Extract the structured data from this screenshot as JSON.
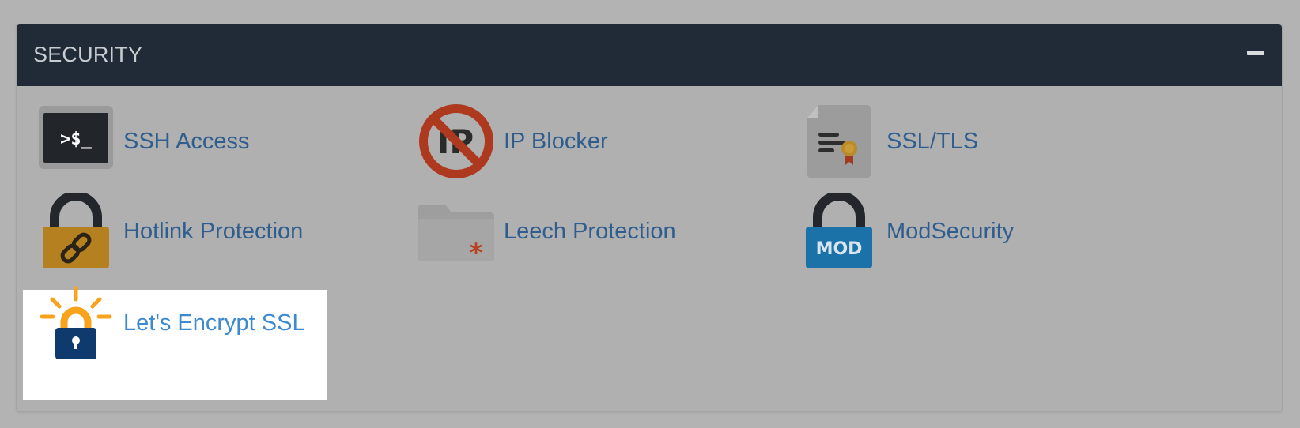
{
  "section": {
    "title": "SECURITY",
    "collapse_icon": "minus-icon"
  },
  "colors": {
    "header_bg": "#212b38",
    "panel_bg": "#b0b0b0",
    "link": "#2f5e8e",
    "link_highlight": "#3d8ad0",
    "highlight_bg": "#ffffff"
  },
  "tools": [
    {
      "label": "SSH Access",
      "icon": "terminal-icon"
    },
    {
      "label": "IP Blocker",
      "icon": "ip-blocked-icon"
    },
    {
      "label": "SSL/TLS",
      "icon": "certificate-icon"
    },
    {
      "label": "Hotlink Protection",
      "icon": "padlock-link-icon"
    },
    {
      "label": "Leech Protection",
      "icon": "folder-asterisk-icon"
    },
    {
      "label": "ModSecurity",
      "icon": "padlock-mod-icon"
    },
    {
      "label": "Let's Encrypt SSL",
      "icon": "lets-encrypt-icon",
      "highlighted": true
    }
  ],
  "icon_text": {
    "terminal": ">$_",
    "ip": "IP",
    "mod": "MOD"
  }
}
